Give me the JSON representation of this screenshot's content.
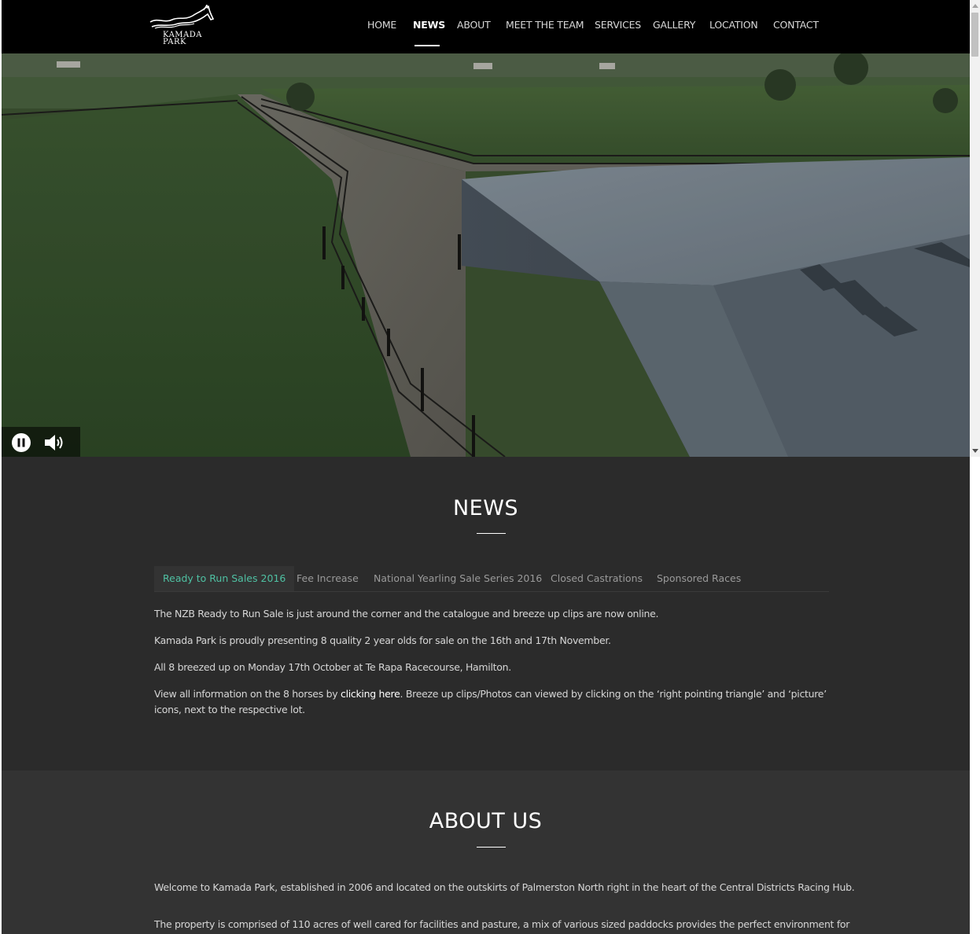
{
  "brand": {
    "logo_line1": "KAMADA",
    "logo_line2": "PARK"
  },
  "nav": {
    "items": [
      {
        "label": "HOME"
      },
      {
        "label": "NEWS"
      },
      {
        "label": "ABOUT"
      },
      {
        "label": "MEET THE TEAM"
      },
      {
        "label": "SERVICES"
      },
      {
        "label": "GALLERY"
      },
      {
        "label": "LOCATION"
      },
      {
        "label": "CONTACT"
      }
    ],
    "active": "NEWS"
  },
  "hero": {
    "controls": [
      "pause-icon",
      "volume-icon"
    ]
  },
  "news": {
    "title": "NEWS",
    "tabs": [
      {
        "label": "Ready to Run Sales 2016"
      },
      {
        "label": "Fee Increase"
      },
      {
        "label": "National Yearling Sale Series 2016"
      },
      {
        "label": "Closed Castrations"
      },
      {
        "label": "Sponsored Races"
      }
    ],
    "active_tab": "Ready to Run Sales 2016",
    "paragraphs": [
      "The NZB Ready to Run Sale is just around the corner and the catalogue and breeze up clips are now online.",
      "Kamada Park is proudly presenting 8 quality 2 year olds for sale on the 16th and 17th November.",
      "All 8 breezed up on Monday 17th October at Te Rapa Racecourse, Hamilton."
    ],
    "info": {
      "before": "View all information on the 8 horses by ",
      "link": "clicking here",
      "after": ". Breeze up clips/Photos can viewed by clicking on the ‘right pointing triangle’ and ‘picture’ icons, next to the respective lot."
    }
  },
  "about": {
    "title": "ABOUT US",
    "paragraphs": [
      "Welcome to Kamada Park, established in 2006 and located on the outskirts of Palmerston North right in the heart of the Central Districts Racing Hub.",
      "The property is comprised of 110 acres of well cared for facilities and pasture, a mix of various sized paddocks provides the perfect environment for"
    ]
  },
  "colors": {
    "accent": "#4fc1a3",
    "header_bg": "#000000",
    "news_bg": "#2b2b2b",
    "about_bg": "#333333"
  }
}
